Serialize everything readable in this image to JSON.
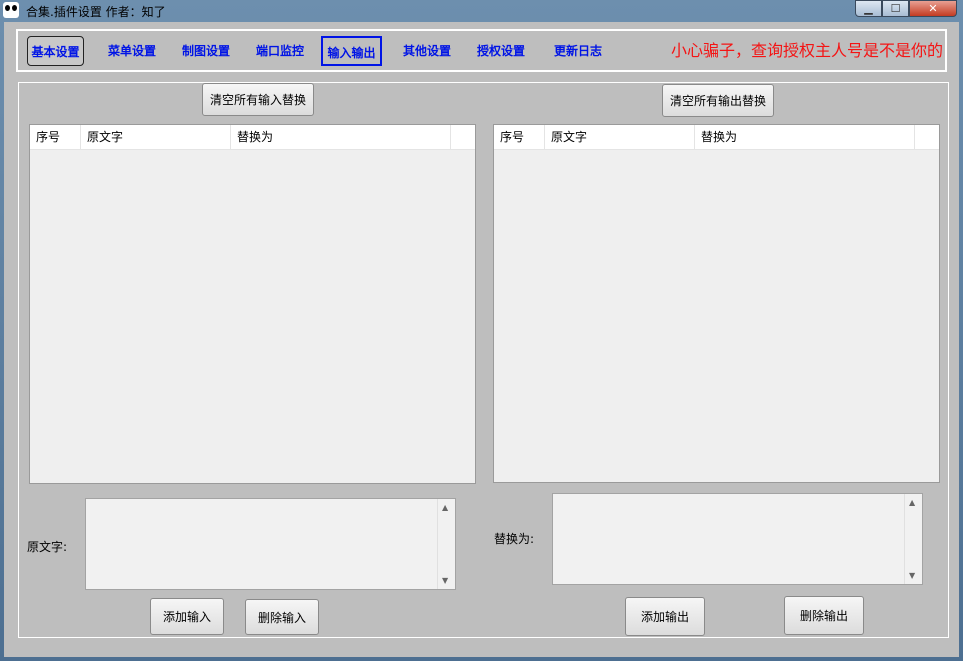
{
  "window": {
    "title": "合集.插件设置  作者：知了",
    "controls": {
      "minimize": "▁",
      "maximize": "☐",
      "close": "✕"
    }
  },
  "tabs": [
    {
      "label": "基本设置"
    },
    {
      "label": "菜单设置"
    },
    {
      "label": "制图设置"
    },
    {
      "label": "端口监控"
    },
    {
      "label": "输入输出",
      "active": true
    },
    {
      "label": "其他设置"
    },
    {
      "label": "授权设置"
    },
    {
      "label": "更新日志"
    }
  ],
  "warning_text": "小心骗子，查询授权主人号是不是你的",
  "colors": {
    "tab_text": "#0014e6",
    "warning": "#f41414",
    "background": "#bebebe"
  },
  "input_section": {
    "clear_button": "清空所有输入替换",
    "columns": [
      "序号",
      "原文字",
      "替换为"
    ],
    "rows": [],
    "field_label": "原文字:",
    "add_button": "添加输入",
    "delete_button": "删除输入"
  },
  "output_section": {
    "clear_button": "清空所有输出替换",
    "columns": [
      "序号",
      "原文字",
      "替换为"
    ],
    "rows": [],
    "field_label": "替换为:",
    "add_button": "添加输出",
    "delete_button": "删除输出"
  },
  "scroll_arrows": {
    "up": "▲",
    "down": "▼"
  }
}
